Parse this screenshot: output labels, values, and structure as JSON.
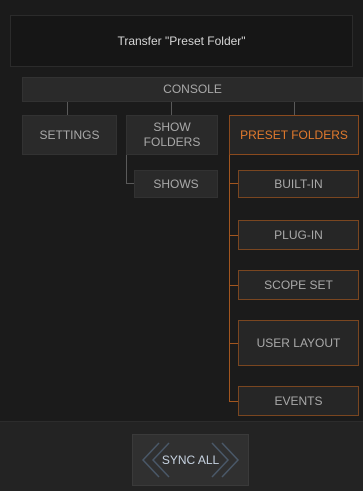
{
  "title": "Transfer \"Preset Folder\"",
  "tree": {
    "root": "CONSOLE",
    "settings": "SETTINGS",
    "show_folders": "SHOW\nFOLDERS",
    "shows": "SHOWS",
    "preset_folders": "PRESET FOLDERS",
    "preset_children": [
      "BUILT-IN",
      "PLUG-IN",
      "SCOPE SET",
      "USER LAYOUT",
      "EVENTS"
    ]
  },
  "footer": {
    "sync_all_label": "SYNC ALL"
  },
  "colors": {
    "accent": "#e27a2d",
    "connector": "#5a5a5a",
    "connector_active": "#a2561f"
  }
}
